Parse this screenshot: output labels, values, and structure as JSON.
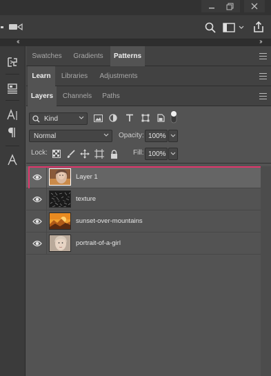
{
  "window": {
    "minimize_icon": "minimize-icon",
    "restore_icon": "restore-icon",
    "close_icon": "close-icon"
  },
  "options_bar": {
    "icons": [
      "camera-icon",
      "search-icon",
      "workspace-icon",
      "chevron-down-icon",
      "share-icon"
    ]
  },
  "panels": {
    "row1": {
      "tabs": [
        "Swatches",
        "Gradients",
        "Patterns"
      ],
      "active": "Patterns"
    },
    "row2": {
      "tabs": [
        "Learn",
        "Libraries",
        "Adjustments"
      ],
      "active": "Learn"
    },
    "row3": {
      "tabs": [
        "Layers",
        "Channels",
        "Paths"
      ],
      "active": "Layers"
    }
  },
  "layers": {
    "filter_kind": "Kind",
    "blend_mode": "Normal",
    "opacity_label": "Opacity:",
    "opacity_value": "100%",
    "lock_label": "Lock:",
    "fill_label": "Fill:",
    "fill_value": "100%",
    "items": [
      {
        "name": "Layer 1",
        "selected": true,
        "visible": true,
        "thumb": "portrait-blend"
      },
      {
        "name": "texture",
        "selected": false,
        "visible": true,
        "thumb": "texture"
      },
      {
        "name": "sunset-over-mountains",
        "selected": false,
        "visible": true,
        "thumb": "sunset"
      },
      {
        "name": "portrait-of-a-girl",
        "selected": false,
        "visible": true,
        "thumb": "portrait"
      }
    ]
  },
  "colors": {
    "selection_outline": "#e0356b",
    "panel_bg": "#535353",
    "tab_bar_bg": "#424242"
  }
}
